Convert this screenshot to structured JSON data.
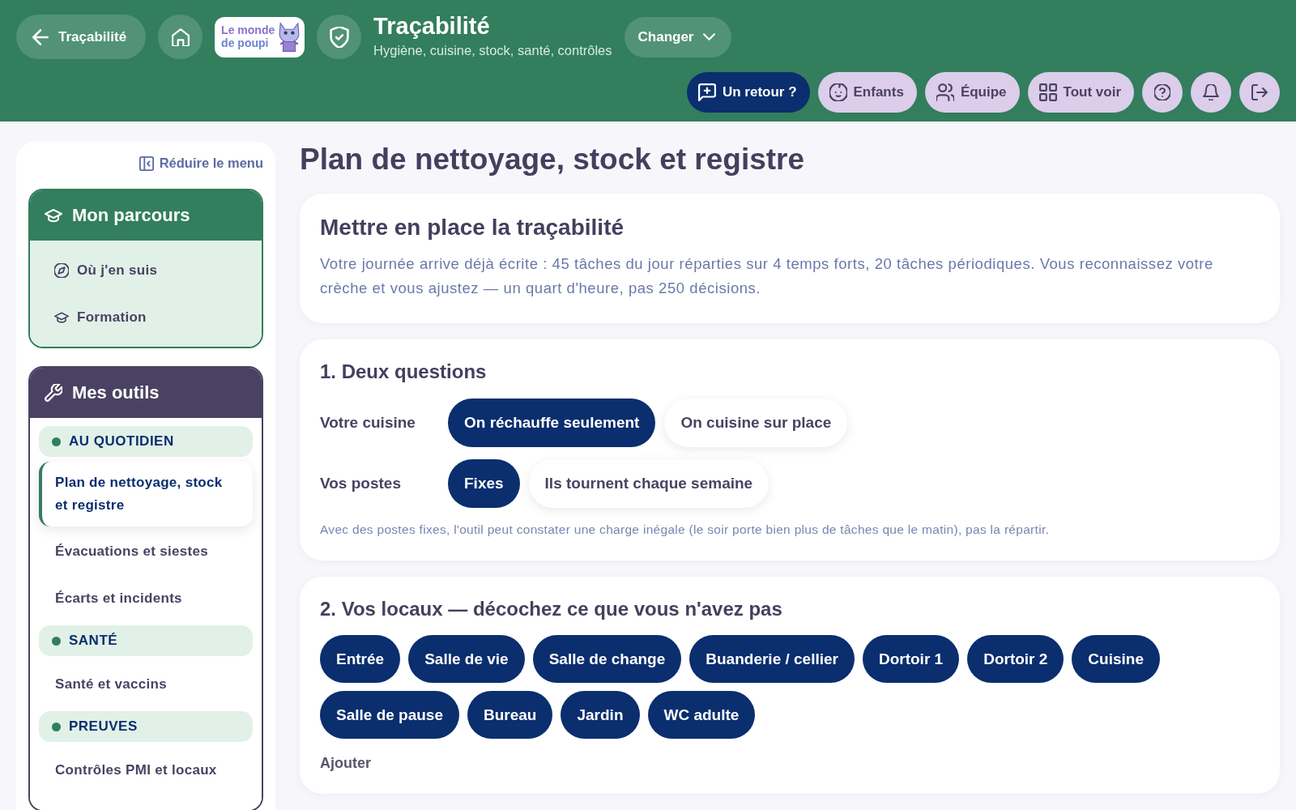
{
  "header": {
    "back_button": {
      "label": "Traçabilité"
    },
    "logo": {
      "lines": [
        "Le monde",
        "de poupi"
      ]
    },
    "title": "Traçabilité",
    "subtitle": "Hygiène, cuisine, stock, santé, contrôles",
    "switch_button": {
      "label": "Changer"
    },
    "actions": [
      {
        "kind": "primary",
        "label": "Un retour ?"
      },
      {
        "kind": "secondary",
        "label": "Enfants"
      },
      {
        "kind": "secondary",
        "label": "Équipe"
      },
      {
        "kind": "secondary",
        "label": "Tout voir"
      }
    ]
  },
  "sidebar": {
    "collapse_link": "Réduire le menu",
    "journey": {
      "title": "Mon parcours",
      "items": [
        {
          "label": "Où j'en suis",
          "selected": false
        },
        {
          "label": "Formation",
          "selected": false
        }
      ]
    },
    "tools": {
      "title": "Mes outils",
      "sections": [
        {
          "title": "AU QUOTIDIEN",
          "items": [
            {
              "label": "Plan de nettoyage, stock et registre",
              "selected": true
            },
            {
              "label": "Évacuations et siestes",
              "selected": false
            },
            {
              "label": "Écarts et incidents",
              "selected": false
            }
          ]
        },
        {
          "title": "SANTÉ",
          "items": [
            {
              "label": "Santé et vaccins",
              "selected": false
            }
          ]
        },
        {
          "title": "PREUVES",
          "items": [
            {
              "label": "Contrôles PMI et locaux",
              "selected": false
            }
          ]
        }
      ]
    }
  },
  "page_title": "Plan de nettoyage, stock et registre",
  "intro_card": {
    "title": "Mettre en place la traçabilité",
    "text": "Votre journée arrive déjà écrite : 45 tâches du jour réparties sur 4 temps forts, 20 tâches périodiques. Vous reconnaissez votre crèche et vous ajustez — un quart d'heure, pas 250 décisions."
  },
  "questions_card": {
    "title": "1. Deux questions",
    "questions": [
      {
        "label": "Votre cuisine",
        "options": [
          {
            "label": "On réchauffe seulement",
            "selected": true
          },
          {
            "label": "On cuisine sur place",
            "selected": false
          }
        ]
      },
      {
        "label": "Vos postes",
        "options": [
          {
            "label": "Fixes",
            "selected": true
          },
          {
            "label": "Ils tournent chaque semaine",
            "selected": false
          }
        ]
      }
    ],
    "note": "Avec des postes fixes, l'outil peut constater une charge inégale (le soir porte bien plus de tâches que le matin), pas la répartir."
  },
  "rooms_card": {
    "title": "2. Vos locaux — décochez ce que vous n'avez pas",
    "rooms": [
      {
        "label": "Entrée",
        "selected": true
      },
      {
        "label": "Salle de vie",
        "selected": true
      },
      {
        "label": "Salle de change",
        "selected": true
      },
      {
        "label": "Buanderie / cellier",
        "selected": true
      },
      {
        "label": "Dortoir 1",
        "selected": true
      },
      {
        "label": "Dortoir 2",
        "selected": true
      },
      {
        "label": "Cuisine",
        "selected": true
      },
      {
        "label": "Salle de pause",
        "selected": true
      },
      {
        "label": "Bureau",
        "selected": true
      },
      {
        "label": "Jardin",
        "selected": true
      },
      {
        "label": "WC adulte",
        "selected": true
      }
    ],
    "add_label": "Ajouter"
  }
}
